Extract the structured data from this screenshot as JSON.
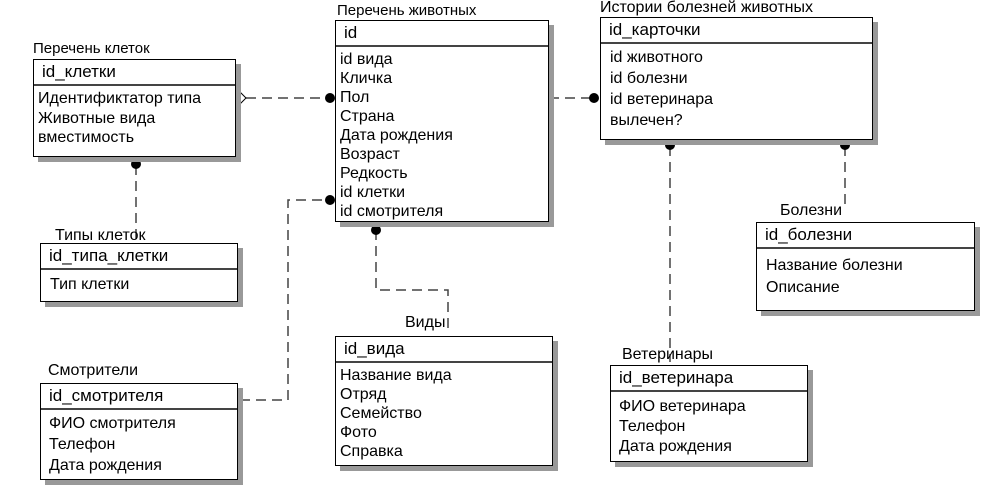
{
  "entities": {
    "cells": {
      "title": "Перечень клеток",
      "key": "id_клетки",
      "fields": [
        "Идентификтатор типа",
        "Животные вида",
        "вместимость"
      ]
    },
    "animals": {
      "title": "Перечень животных",
      "key": "id",
      "fields": [
        "id вида",
        "Кличка",
        "Пол",
        "Страна",
        "Дата рождения",
        "Возраст",
        "Редкость",
        "id клетки",
        "id смотрителя"
      ]
    },
    "history": {
      "title": "Истории болезней животных",
      "key": "id_карточки",
      "fields": [
        "id животного",
        "id болезни",
        "id ветеринара",
        "вылечен?"
      ]
    },
    "types": {
      "title": "Типы клеток",
      "key": "id_типа_клетки",
      "fields": [
        "Тип клетки"
      ]
    },
    "keepers": {
      "title": "Смотрители",
      "key": "id_смотрителя",
      "fields": [
        "ФИО смотрителя",
        "Телефон",
        "Дата рождения"
      ]
    },
    "species": {
      "title": "Виды",
      "key": "id_вида",
      "fields": [
        "Название вида",
        "Отряд",
        "Семейство",
        "Фото",
        "Справка"
      ]
    },
    "diseases": {
      "title": "Болезни",
      "key": "id_болезни",
      "fields": [
        "Название болезни",
        "Описание"
      ]
    },
    "vets": {
      "title": "Ветеринары",
      "key": "id_ветеринара",
      "fields": [
        "ФИО ветеринара",
        "Телефон",
        "Дата рождения"
      ]
    }
  }
}
